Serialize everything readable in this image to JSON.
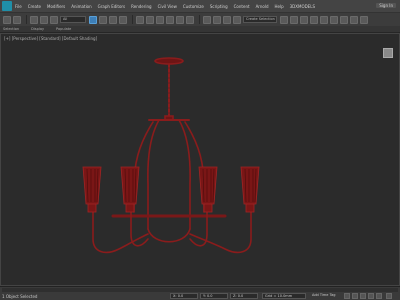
{
  "menubar": {
    "items": [
      "File",
      "Create",
      "Modifiers",
      "Animation",
      "Graph Editors",
      "Rendering",
      "Civil View",
      "Customize",
      "Scripting",
      "Content",
      "Arnold",
      "Help",
      "3DXMODELS"
    ],
    "signin_label": "Sign In"
  },
  "toolbar": {
    "filter_value": "All",
    "selection_set_value": "Create Selection Se"
  },
  "ribbon": {
    "tabs": [
      "Selection",
      "Display",
      "Populate"
    ]
  },
  "viewport": {
    "label": "[+] [Perspective] [Standard] [Default Shading]",
    "colors": {
      "model": "#8a1c1c",
      "model_dark": "#5a0f0f",
      "background": "#2b2b2b"
    }
  },
  "statusbar": {
    "status_text": "1 Object Selected",
    "coord_x": "X: 0.0",
    "coord_y": "Y: 0.0",
    "coord_z": "Z: 0.0",
    "grid": "Grid = 10.0mm",
    "add_time_tag": "Add Time Tag"
  }
}
